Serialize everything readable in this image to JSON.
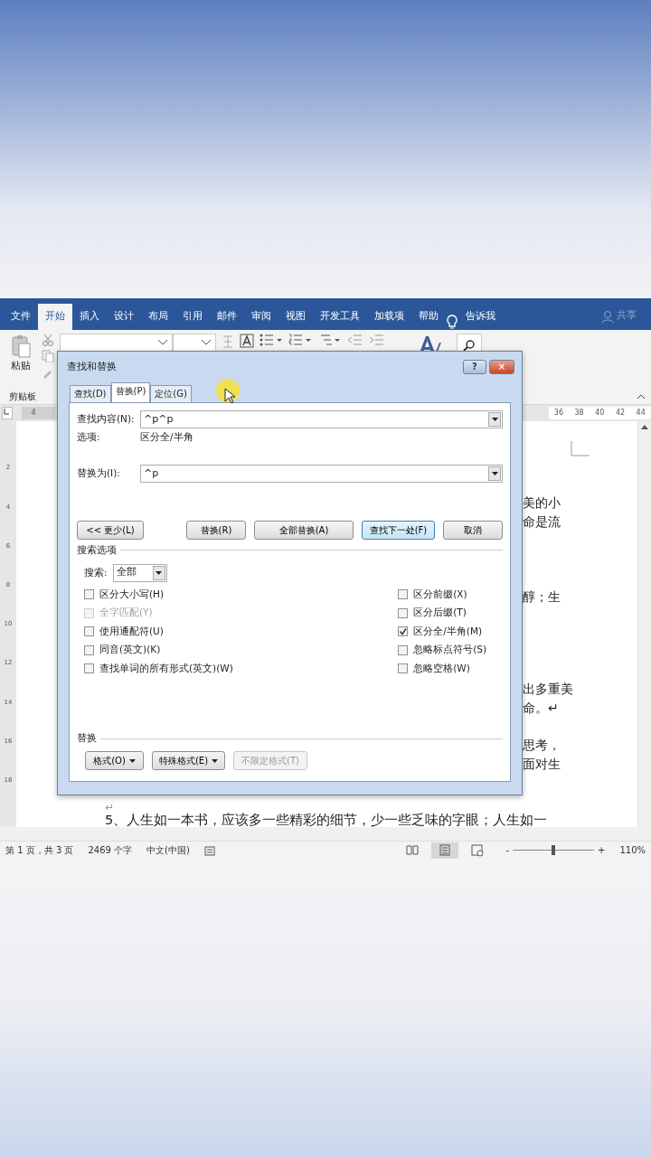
{
  "ribbon": {
    "tabs": [
      {
        "label": "文件",
        "selected": false
      },
      {
        "label": "开始",
        "selected": true
      },
      {
        "label": "插入",
        "selected": false
      },
      {
        "label": "设计",
        "selected": false
      },
      {
        "label": "布局",
        "selected": false
      },
      {
        "label": "引用",
        "selected": false
      },
      {
        "label": "邮件",
        "selected": false
      },
      {
        "label": "审阅",
        "selected": false
      },
      {
        "label": "视图",
        "selected": false
      },
      {
        "label": "开发工具",
        "selected": false
      },
      {
        "label": "加载项",
        "selected": false
      },
      {
        "label": "帮助",
        "selected": false
      }
    ],
    "tell_me": "告诉我",
    "share": "共享",
    "paste_label": "粘贴",
    "group_label": "剪贴板"
  },
  "ruler": {
    "left_numbers": [
      "4"
    ],
    "right_numbers": [
      "36",
      "38",
      "40",
      "42",
      "44"
    ]
  },
  "vertical_ruler": [
    "2",
    "4",
    "6",
    "8",
    "10",
    "12",
    "14",
    "16",
    "18"
  ],
  "document": {
    "side_paragraphs": [
      [
        "美的小",
        "命是流"
      ],
      [
        "醇；生"
      ],
      [
        "出多重美",
        "命。↵"
      ],
      [
        "思考，",
        "面对生"
      ]
    ],
    "mark": "↵",
    "bottom_line": "5、人生如一本书，应该多一些精彩的细节，少一些乏味的字眼；人生如一"
  },
  "dialog": {
    "title": "查找和替换",
    "help": "?",
    "close": "×",
    "tabs": [
      {
        "label": "查找(D)",
        "selected": false
      },
      {
        "label": "替换(P)",
        "selected": true
      },
      {
        "label": "定位(G)",
        "selected": false
      }
    ],
    "find_label": "查找内容(N):",
    "find_value": "^p^p",
    "options_label": "选项:",
    "options_value": "区分全/半角",
    "replace_label": "替换为(I):",
    "replace_value": "^p",
    "buttons": [
      {
        "label": "<< 更少(L)",
        "kind": "left",
        "default": false
      },
      {
        "label": "替换(R)",
        "kind": "right",
        "default": false
      },
      {
        "label": "全部替换(A)",
        "kind": "right",
        "default": false
      },
      {
        "label": "查找下一处(F)",
        "kind": "right",
        "default": true
      },
      {
        "label": "取消",
        "kind": "right",
        "default": false
      }
    ],
    "search_options_title": "搜索选项",
    "search_label": "搜索:",
    "search_value": "全部",
    "left_checks": [
      {
        "label": "区分大小写(H)",
        "checked": false,
        "disabled": false
      },
      {
        "label": "全字匹配(Y)",
        "checked": false,
        "disabled": true
      },
      {
        "label": "使用通配符(U)",
        "checked": false,
        "disabled": false
      },
      {
        "label": "同音(英文)(K)",
        "checked": false,
        "disabled": false
      },
      {
        "label": "查找单词的所有形式(英文)(W)",
        "checked": false,
        "disabled": false
      }
    ],
    "right_checks": [
      {
        "label": "区分前缀(X)",
        "checked": false,
        "disabled": false
      },
      {
        "label": "区分后缀(T)",
        "checked": false,
        "disabled": false
      },
      {
        "label": "区分全/半角(M)",
        "checked": true,
        "disabled": false
      },
      {
        "label": "忽略标点符号(S)",
        "checked": false,
        "disabled": false
      },
      {
        "label": "忽略空格(W)",
        "checked": false,
        "disabled": false
      }
    ],
    "replace_title": "替换",
    "format_buttons": [
      {
        "label": "格式(O)",
        "caret": true,
        "disabled": false
      },
      {
        "label": "特殊格式(E)",
        "caret": true,
        "disabled": false
      },
      {
        "label": "不限定格式(T)",
        "caret": false,
        "disabled": true
      }
    ]
  },
  "status_bar": {
    "page": "第 1 页，共 3 页",
    "words": "2469 个字",
    "language": "中文(中国)",
    "views": [
      {
        "kind": "read",
        "selected": false
      },
      {
        "kind": "print",
        "selected": true
      },
      {
        "kind": "web",
        "selected": false
      }
    ],
    "zoom_minus": "-",
    "zoom_plus": "+",
    "zoom": {
      "level": 0.5
    },
    "zoom_percent": "110%"
  }
}
